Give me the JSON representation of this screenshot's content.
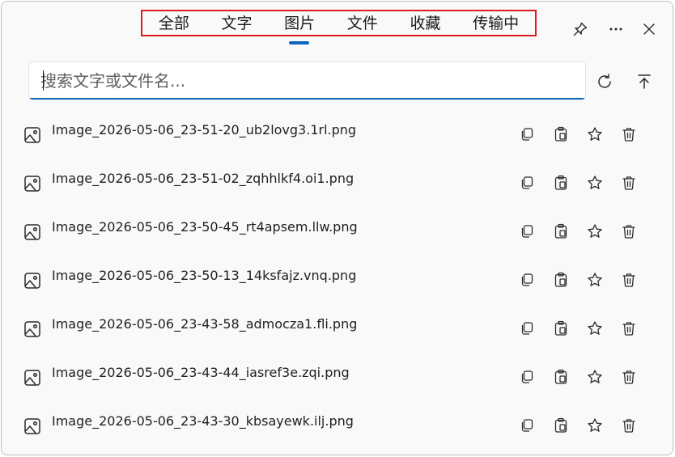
{
  "tabs": [
    {
      "label": "全部"
    },
    {
      "label": "文字"
    },
    {
      "label": "图片"
    },
    {
      "label": "文件"
    },
    {
      "label": "收藏"
    },
    {
      "label": "传输中"
    }
  ],
  "active_tab": "图片",
  "window_controls": {
    "pin": "pin-icon",
    "more": "more-icon",
    "close": "close-icon"
  },
  "search": {
    "placeholder": "搜索文字或文件名...",
    "value": ""
  },
  "toolbar": {
    "refresh": "refresh-icon",
    "scroll_top": "scroll-top-icon"
  },
  "files": [
    {
      "name": "Image_2026-05-06_23-51-20_ub2lovg3.1rl.png"
    },
    {
      "name": "Image_2026-05-06_23-51-02_zqhhlkf4.oi1.png"
    },
    {
      "name": "Image_2026-05-06_23-50-45_rt4apsem.llw.png"
    },
    {
      "name": "Image_2026-05-06_23-50-13_14ksfajz.vnq.png"
    },
    {
      "name": "Image_2026-05-06_23-43-58_admocza1.fli.png"
    },
    {
      "name": "Image_2026-05-06_23-43-44_iasref3e.zqi.png"
    },
    {
      "name": "Image_2026-05-06_23-43-30_kbsayewk.ilj.png"
    }
  ],
  "row_actions": [
    "copy-icon",
    "paste-icon",
    "star-icon",
    "trash-icon"
  ],
  "colors": {
    "accent": "#0e65c0",
    "highlight_border": "#e0191f",
    "icon": "#2b2b2b"
  }
}
